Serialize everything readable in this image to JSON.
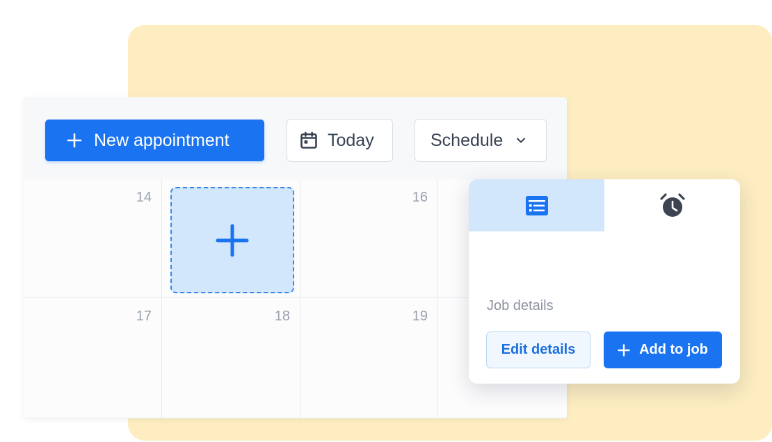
{
  "toolbar": {
    "new_appointment_label": "New appointment",
    "today_label": "Today",
    "schedule_label": "Schedule"
  },
  "calendar": {
    "days": [
      "14",
      "16",
      "17",
      "18",
      "19"
    ]
  },
  "popup": {
    "job_details_label": "Job details",
    "edit_label": "Edit details",
    "add_label": "Add to job"
  },
  "colors": {
    "primary": "#1a73f0",
    "accent_light": "#d2e7fb",
    "background_card": "#fdedc1",
    "muted_text": "#9aa1ad"
  },
  "icons": [
    "plus-icon",
    "calendar-icon",
    "chevron-down-icon",
    "details-list-icon",
    "alarm-clock-icon"
  ]
}
